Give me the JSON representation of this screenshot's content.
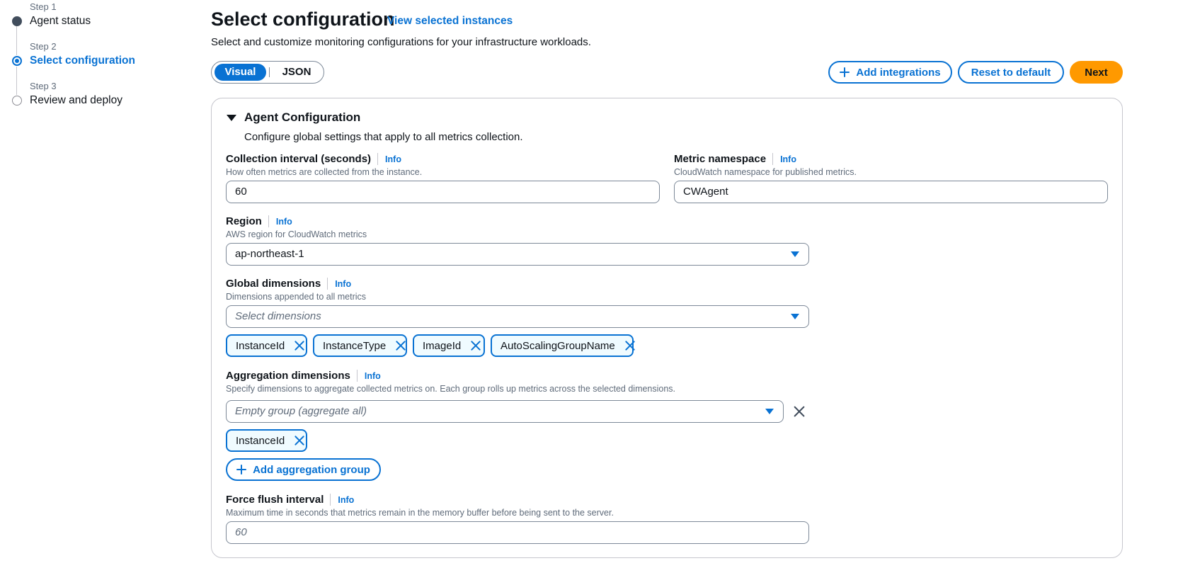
{
  "stepper": {
    "steps": [
      {
        "small": "Step 1",
        "title": "Agent status"
      },
      {
        "small": "Step 2",
        "title": "Select configuration"
      },
      {
        "small": "Step 3",
        "title": "Review and deploy"
      }
    ]
  },
  "header": {
    "title": "Select configuration",
    "view_link": "View selected instances",
    "description": "Select and customize monitoring configurations for your infrastructure workloads."
  },
  "segmented": {
    "options": [
      "Visual",
      "JSON"
    ],
    "selected": "Visual"
  },
  "actions": {
    "add_integrations": "Add integrations",
    "reset": "Reset to default",
    "next": "Next"
  },
  "agent_config": {
    "title": "Agent Configuration",
    "description": "Configure global settings that apply to all metrics collection.",
    "info_label": "Info",
    "collection_interval": {
      "label": "Collection interval (seconds)",
      "hint": "How often metrics are collected from the instance.",
      "value": "60"
    },
    "metric_namespace": {
      "label": "Metric namespace",
      "hint": "CloudWatch namespace for published metrics.",
      "value": "CWAgent"
    },
    "region": {
      "label": "Region",
      "hint": "AWS region for CloudWatch metrics",
      "value": "ap-northeast-1"
    },
    "global_dimensions": {
      "label": "Global dimensions",
      "hint": "Dimensions appended to all metrics",
      "placeholder": "Select dimensions",
      "tokens": [
        "InstanceId",
        "InstanceType",
        "ImageId",
        "AutoScalingGroupName"
      ]
    },
    "aggregation_dimensions": {
      "label": "Aggregation dimensions",
      "hint": "Specify dimensions to aggregate collected metrics on. Each group rolls up metrics across the selected dimensions.",
      "placeholder": "Empty group (aggregate all)",
      "tokens": [
        "InstanceId"
      ],
      "add_group": "Add aggregation group"
    },
    "force_flush": {
      "label": "Force flush interval",
      "hint": "Maximum time in seconds that metrics remain in the memory buffer before being sent to the server.",
      "placeholder": "60"
    }
  },
  "colors": {
    "accent": "#0972d3",
    "primary_button": "#ff9900",
    "token_bg": "#f0fbff"
  }
}
